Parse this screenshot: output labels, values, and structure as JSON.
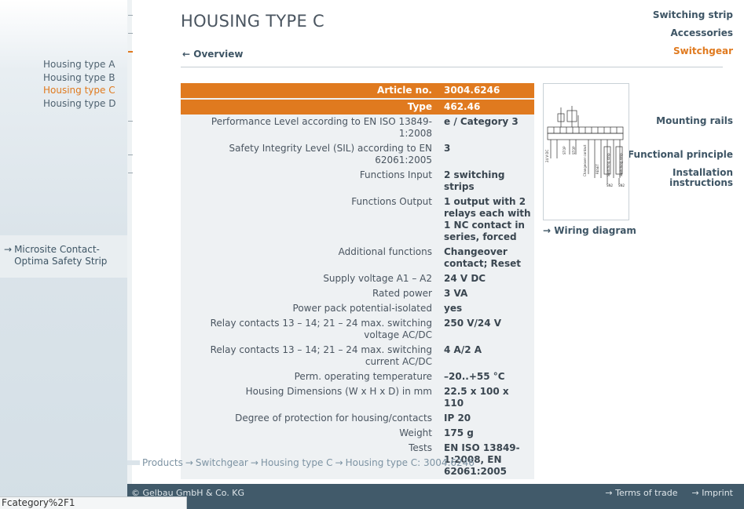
{
  "sidebar": {
    "nav": [
      {
        "label": "Switching strip"
      },
      {
        "label": "Accessories"
      },
      {
        "label": "Switchgear"
      },
      {
        "label": "Mounting rails"
      },
      {
        "label": "Functional principle"
      },
      {
        "label": "Installation instructions"
      }
    ],
    "sub": [
      {
        "label": "Housing type A"
      },
      {
        "label": "Housing type B"
      },
      {
        "label": "Housing type C"
      },
      {
        "label": "Housing type D"
      }
    ],
    "microsite": {
      "label": "Microsite Contact-Optima Safety Strip"
    }
  },
  "main": {
    "title": "HOUSING TYPE C",
    "overview_link": "Overview",
    "wiring_link": "Wiring diagram",
    "specs": [
      {
        "label": "Article no.",
        "value": "3004.6246"
      },
      {
        "label": "Type",
        "value": "462.46"
      },
      {
        "label": "Performance Level according to EN ISO 13849-1:2008",
        "value": "e / Category 3"
      },
      {
        "label": "Safety Integrity Level (SIL) according to EN 62061:2005",
        "value": "3"
      },
      {
        "label": "Functions Input",
        "value": "2 switching strips"
      },
      {
        "label": "Functions Output",
        "value": "1 output with 2 relays each with 1 NC contact in series, forced"
      },
      {
        "label": "Additional functions",
        "value": "Changeover contact; Reset"
      },
      {
        "label": "Supply voltage A1 – A2",
        "value": "24 V DC"
      },
      {
        "label": "Rated power",
        "value": "3 VA"
      },
      {
        "label": "Power pack potential-isolated",
        "value": "yes"
      },
      {
        "label": "Relay contacts 13 – 14; 21 – 24 max. switching voltage AC/DC",
        "value": "250 V/24 V"
      },
      {
        "label": "Relay contacts 13 – 14; 21 – 24 max. switching current AC/DC",
        "value": "4 A/2 A"
      },
      {
        "label": "Perm. operating temperature",
        "value": "–20..+55 °C"
      },
      {
        "label": "Housing Dimensions (W x H x D) in mm",
        "value": "22.5 x 100 x 110"
      },
      {
        "label": "Degree of protection for housing/contacts",
        "value": "IP 20"
      },
      {
        "label": "Weight",
        "value": "175 g"
      },
      {
        "label": "Tests",
        "value": "EN ISO 13849-1:2008, EN 62061:2005"
      }
    ]
  },
  "breadcrumb": [
    "Products",
    "Switchgear",
    "Housing type C",
    "Housing type C: 3004.6246"
  ],
  "footer": {
    "copyright": "© Gelbau GmbH & Co. KG",
    "terms": "Terms of trade",
    "imprint": "Imprint"
  },
  "status_bar": "Fcategory%2F1",
  "colors": {
    "accent": "#e07a1f",
    "nav": "#3e5565",
    "footer": "#415a6a"
  }
}
